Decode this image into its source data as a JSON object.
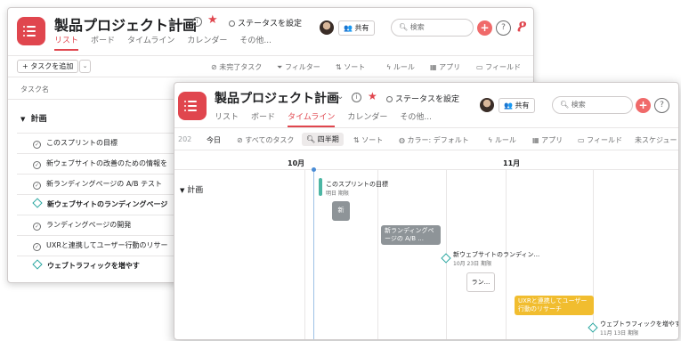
{
  "back_window": {
    "title": "製品プロジェクト計画",
    "status_label": "ステータスを設定",
    "tabs": [
      "リスト",
      "ボード",
      "タイムライン",
      "カレンダー",
      "その他..."
    ],
    "share_label": "共有",
    "search_placeholder": "検索",
    "toolbar": {
      "add_task": "+ タスクを追加",
      "incomplete": "未完了タスク",
      "filter": "フィルター",
      "sort": "ソート",
      "rules": "ルール",
      "apps": "アプリ",
      "fields": "フィールド"
    },
    "column_header": "タスク名",
    "section_title": "計画",
    "tasks": [
      {
        "name": "このスプリントの目標",
        "type": "task"
      },
      {
        "name": "新ウェブサイトの改善のための情報を",
        "type": "task"
      },
      {
        "name": "新ランディングページの A/B テスト",
        "type": "task"
      },
      {
        "name": "新ウェブサイトのランディングページ",
        "type": "milestone"
      },
      {
        "name": "ランディングページの開発",
        "type": "task"
      },
      {
        "name": "UXRと連携してユーザー行動のリサー",
        "type": "task"
      },
      {
        "name": "ウェブトラフィックを増やす",
        "type": "milestone"
      }
    ]
  },
  "front_window": {
    "title": "製品プロジェクト計画",
    "status_label": "ステータスを設定",
    "tabs": [
      "リスト",
      "ボード",
      "タイムライン",
      "カレンダー",
      "その他..."
    ],
    "active_tab": "タイムライン",
    "share_label": "共有",
    "search_placeholder": "検索",
    "toolbar": {
      "year_fragment": "202",
      "today": "今日",
      "all_tasks": "すべてのタスク",
      "quarter": "四半期",
      "sort": "ソート",
      "color": "カラー: デフォルト",
      "rules": "ルール",
      "apps": "アプリ",
      "fields": "フィールド",
      "unscheduled": "未スケジュー"
    },
    "months": [
      "10月",
      "11月"
    ],
    "section_title": "計画",
    "timeline_items": {
      "goal_title": "このスプリントの目標",
      "goal_sub": "明日 期限",
      "new_badge": "新",
      "ab_test": "新ランディングページの A/B ...",
      "landing_ms_title": "新ウェブサイトのランディン...",
      "landing_ms_sub": "10月 23日 期限",
      "dev_card": "ラン...",
      "uxr_bar": "UXRと連携してユーザー行動のリサーチ",
      "traffic_ms_title": "ウェブトラフィックを増やす",
      "traffic_ms_sub": "11月 13日 期限"
    }
  },
  "colors": {
    "brand_red": "#e0464e",
    "plus_coral": "#f06a6a",
    "milestone_teal": "#2aa6a0",
    "gray_bar": "#8e9498",
    "yellow_bar": "#f1bd2f",
    "today_blue": "#4a8cd6"
  }
}
